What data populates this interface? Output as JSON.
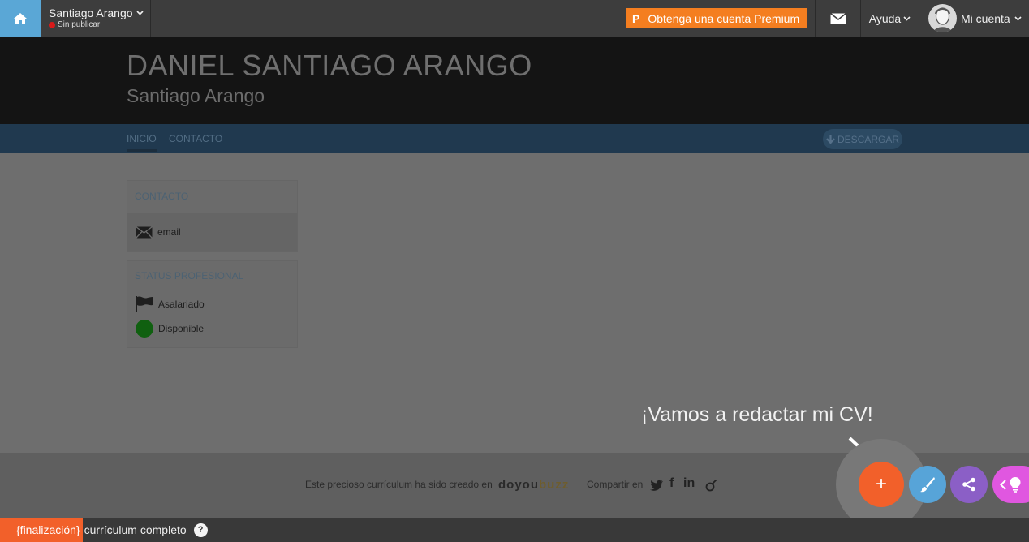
{
  "topbar": {
    "profile_name": "Santiago Arango",
    "profile_status": "Sin publicar",
    "premium_label": "Obtenga una cuenta Premium",
    "premium_badge": "P",
    "help_label": "Ayuda",
    "account_label": "Mi cuenta",
    "icons": [
      "home-icon",
      "chevron-down-icon",
      "mail-icon",
      "avatar",
      "premium-badge-icon"
    ]
  },
  "header": {
    "name": "DANIEL SANTIAGO ARANGO",
    "subtitle": "Santiago Arango"
  },
  "nav": {
    "tabs": [
      {
        "label": "INICIO",
        "active": true
      },
      {
        "label": "CONTACTO",
        "active": false
      }
    ],
    "download_label": "DESCARGAR"
  },
  "contact_card": {
    "title": "CONTACTO",
    "email_label": "email"
  },
  "status_card": {
    "title": "STATUS PROFESIONAL",
    "employment": "Asalariado",
    "availability": "Disponible"
  },
  "cta_text": "¡Vamos a redactar mi CV!",
  "footer": {
    "created_text": "Este precioso currículum ha sido creado en",
    "brand": {
      "do": "do",
      "you": "you",
      "buzz": "buzz"
    },
    "share_label": "Compartir en",
    "social": [
      "twitter-icon",
      "facebook-icon",
      "linkedin-icon",
      "viadeo-icon"
    ]
  },
  "fabs": {
    "add_label": "+",
    "icons": [
      "plus-icon",
      "brush-icon",
      "share-icon",
      "chevron-left-icon",
      "lightbulb-icon"
    ]
  },
  "statusbar": {
    "tag": "{finalización}",
    "text": "currículum completo",
    "help": "?"
  },
  "colors": {
    "topbar": "#3d3d3d",
    "home": "#5aa7d6",
    "premium": "#f47e20",
    "header": "#141414",
    "nav": "#20394f",
    "accent_orange": "#f2602a",
    "brush_blue": "#57a4d8",
    "share_purple": "#8b5fc6",
    "tips_pink": "#e057e0",
    "available_green": "#106010"
  }
}
